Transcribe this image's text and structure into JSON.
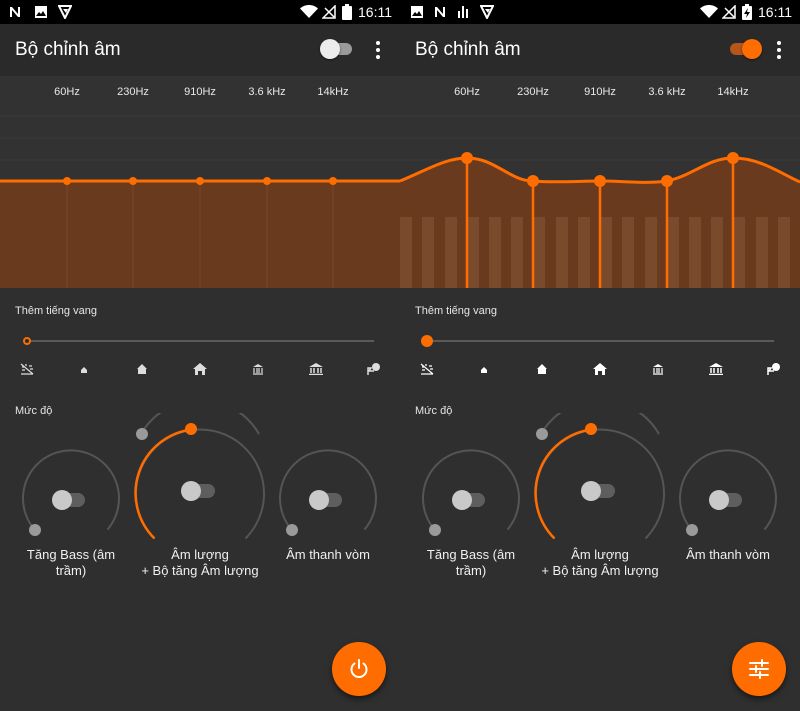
{
  "colors": {
    "accent": "#ff6d00",
    "background": "#2f2f2f",
    "appbar": "#2a2a2a",
    "track_off": "#5a5a5a",
    "knob_thumb": "#c9c9c9"
  },
  "time": "16:11",
  "status_icons_left": [
    "n-icon",
    "image-icon",
    "vpn-icon"
  ],
  "status_icons_left_alt": [
    "image-icon",
    "n-icon",
    "equalizer-bars-icon",
    "vpn-icon"
  ],
  "title": "Bộ chỉnh âm",
  "frequencies": [
    "60Hz",
    "230Hz",
    "910Hz",
    "3.6 kHz",
    "14kHz"
  ],
  "reverb_label": "Thêm tiếng vang",
  "reverb_icons": [
    "none-icon",
    "small-room-icon",
    "medium-room-icon",
    "large-room-icon",
    "medium-hall-icon",
    "large-hall-icon",
    "plate-icon"
  ],
  "level_label": "Mức độ",
  "knobs": {
    "bass": {
      "label_line1": "Tăng Bass (âm",
      "label_line2": "trầm)"
    },
    "volume": {
      "label_line1": "Âm lượng",
      "label_line2": "+ Bộ tăng Âm lượng"
    },
    "surround": {
      "label_line1": "Âm thanh vòm"
    }
  },
  "panes": {
    "left": {
      "master_on": false,
      "eq_levels": [
        0,
        0,
        0,
        0,
        0
      ],
      "fab_icon": "power-icon"
    },
    "right": {
      "master_on": true,
      "eq_levels": [
        0.55,
        0,
        0,
        0,
        0.55
      ],
      "fab_icon": "tune-sliders-icon"
    }
  }
}
